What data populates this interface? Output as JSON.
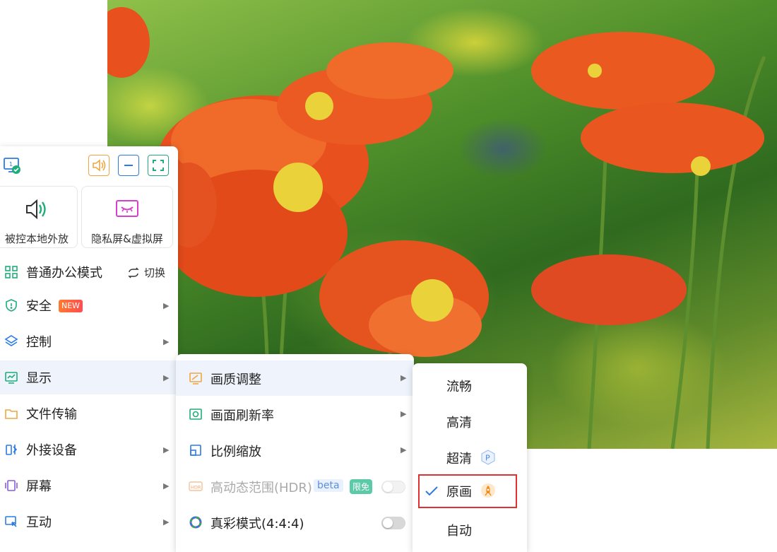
{
  "toolbar": {
    "monitor_icon": "monitor-check-icon",
    "sound_icon": "speaker-icon",
    "minimize_icon": "minimize-icon",
    "fullscreen_icon": "fullscreen-icon"
  },
  "cards": [
    {
      "label": "被控本地外放",
      "icon": "speaker-wave-icon"
    },
    {
      "label": "隐私屏&虚拟屏",
      "icon": "privacy-screen-icon"
    }
  ],
  "menu": {
    "mode": {
      "label": "普通办公模式",
      "switch_label": "切换"
    },
    "items": [
      {
        "label": "安全",
        "badge": "NEW"
      },
      {
        "label": "控制"
      },
      {
        "label": "显示"
      },
      {
        "label": "文件传输"
      },
      {
        "label": "外接设备"
      },
      {
        "label": "屏幕"
      },
      {
        "label": "互动"
      }
    ]
  },
  "display_submenu": [
    {
      "label": "画质调整"
    },
    {
      "label": "画面刷新率"
    },
    {
      "label": "比例缩放"
    },
    {
      "label": "高动态范围(HDR)",
      "tag_beta": "beta",
      "tag_free": "限免",
      "toggle": false
    },
    {
      "label": "真彩模式(4:4:4)",
      "toggle": false
    }
  ],
  "quality_submenu": {
    "options": [
      "流畅",
      "高清",
      "超清",
      "原画",
      "自动"
    ],
    "selected": "原画",
    "premium_badge": "P"
  },
  "colors": {
    "accent": "#2c7be5",
    "active_bg": "#eef3fc",
    "highlight_border": "#e03030",
    "new_badge": "#ff5a3c",
    "free_tag": "#5cc9a7"
  }
}
